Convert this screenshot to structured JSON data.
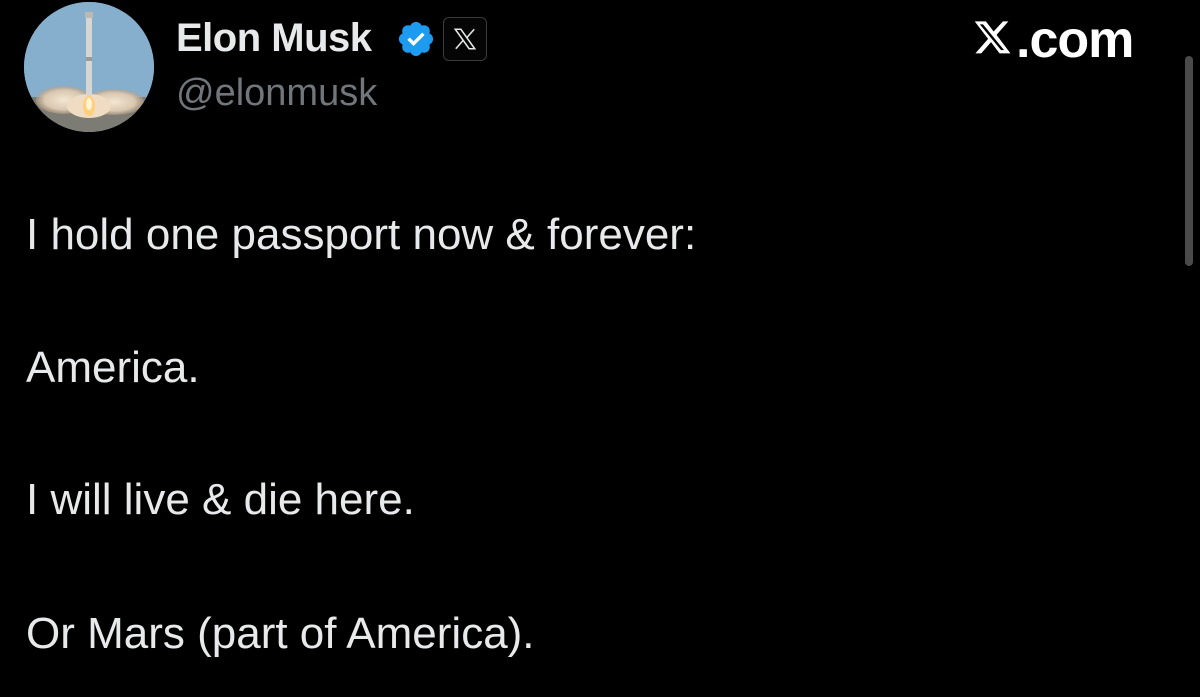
{
  "author": {
    "display_name": "Elon Musk",
    "handle": "@elonmusk",
    "avatar_icon": "rocket-launch-avatar",
    "verified_badge_icon": "verified-badge-icon",
    "affiliate_badge_icon": "x-logo-icon",
    "badge_color": "#1d9bf0"
  },
  "site": {
    "logo_icon": "x-logo-icon",
    "logo_suffix": ".com"
  },
  "tweet": {
    "lines": [
      "I hold one passport now & forever:",
      "America.",
      "I will live & die here.",
      "Or Mars (part of America)."
    ]
  },
  "colors": {
    "background": "#000000",
    "primary_text": "#e7e9ea",
    "secondary_text": "#71767b"
  }
}
